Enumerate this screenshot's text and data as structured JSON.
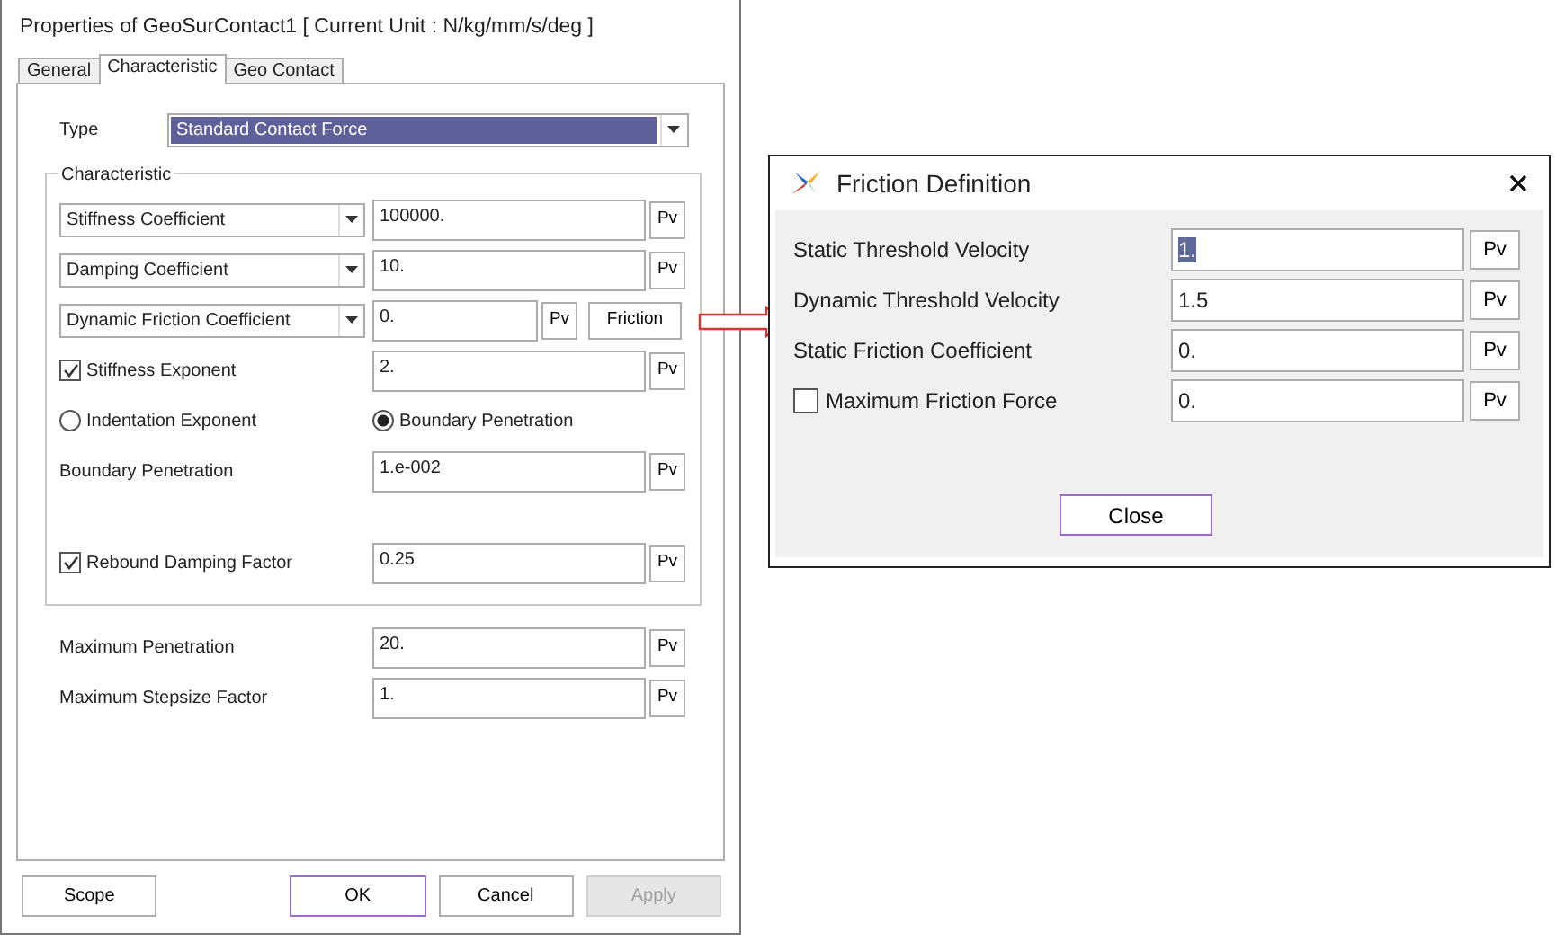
{
  "main_dialog": {
    "title": "Properties of GeoSurContact1 [ Current Unit : N/kg/mm/s/deg ]",
    "tabs": [
      {
        "label": "General",
        "selected": false
      },
      {
        "label": "Characteristic",
        "selected": true
      },
      {
        "label": "Geo Contact",
        "selected": false
      }
    ],
    "type_field": {
      "label": "Type",
      "value": "Standard Contact Force"
    },
    "characteristic_group": {
      "title": "Characteristic",
      "rows": [
        {
          "kind": "combo",
          "label": "Stiffness Coefficient",
          "value": "100000.",
          "pv": "Pv"
        },
        {
          "kind": "combo",
          "label": "Damping Coefficient",
          "value": "10.",
          "pv": "Pv"
        },
        {
          "kind": "combo",
          "label": "Dynamic Friction Coefficient",
          "value": "0.",
          "pv": "Pv",
          "button": "Friction"
        },
        {
          "kind": "checkbox",
          "label": "Stiffness Exponent",
          "checked": true,
          "value": "2.",
          "pv": "Pv"
        },
        {
          "kind": "radios",
          "options": [
            {
              "label": "Indentation Exponent",
              "selected": false
            },
            {
              "label": "Boundary Penetration",
              "selected": true
            }
          ]
        },
        {
          "kind": "field",
          "label": "Boundary Penetration",
          "value": "1.e-002",
          "pv": "Pv"
        },
        {
          "kind": "checkbox",
          "label": "Rebound Damping Factor",
          "checked": true,
          "value": "0.25",
          "pv": "Pv"
        }
      ]
    },
    "lower_rows": [
      {
        "kind": "field",
        "label": "Maximum Penetration",
        "value": "20.",
        "pv": "Pv"
      },
      {
        "kind": "field",
        "label": "Maximum Stepsize Factor",
        "value": "1.",
        "pv": "Pv"
      }
    ],
    "buttons": [
      {
        "label": "Scope",
        "disabled": false,
        "default": false
      },
      {
        "label": "OK",
        "disabled": false,
        "default": true
      },
      {
        "label": "Cancel",
        "disabled": false,
        "default": false
      },
      {
        "label": "Apply",
        "disabled": true,
        "default": false
      }
    ]
  },
  "friction_dialog": {
    "title": "Friction Definition",
    "rows": [
      {
        "kind": "field",
        "label": "Static Threshold Velocity",
        "value": "1.",
        "value_selected": true,
        "pv": "Pv"
      },
      {
        "kind": "field",
        "label": "Dynamic Threshold Velocity",
        "value": "1.5",
        "value_selected": false,
        "pv": "Pv"
      },
      {
        "kind": "field",
        "label": "Static Friction Coefficient",
        "value": "0.",
        "value_selected": false,
        "pv": "Pv"
      },
      {
        "kind": "checkbox",
        "label": "Maximum Friction Force",
        "checked": false,
        "value": "0.",
        "value_selected": false,
        "pv": "Pv"
      }
    ],
    "close_button": "Close"
  }
}
